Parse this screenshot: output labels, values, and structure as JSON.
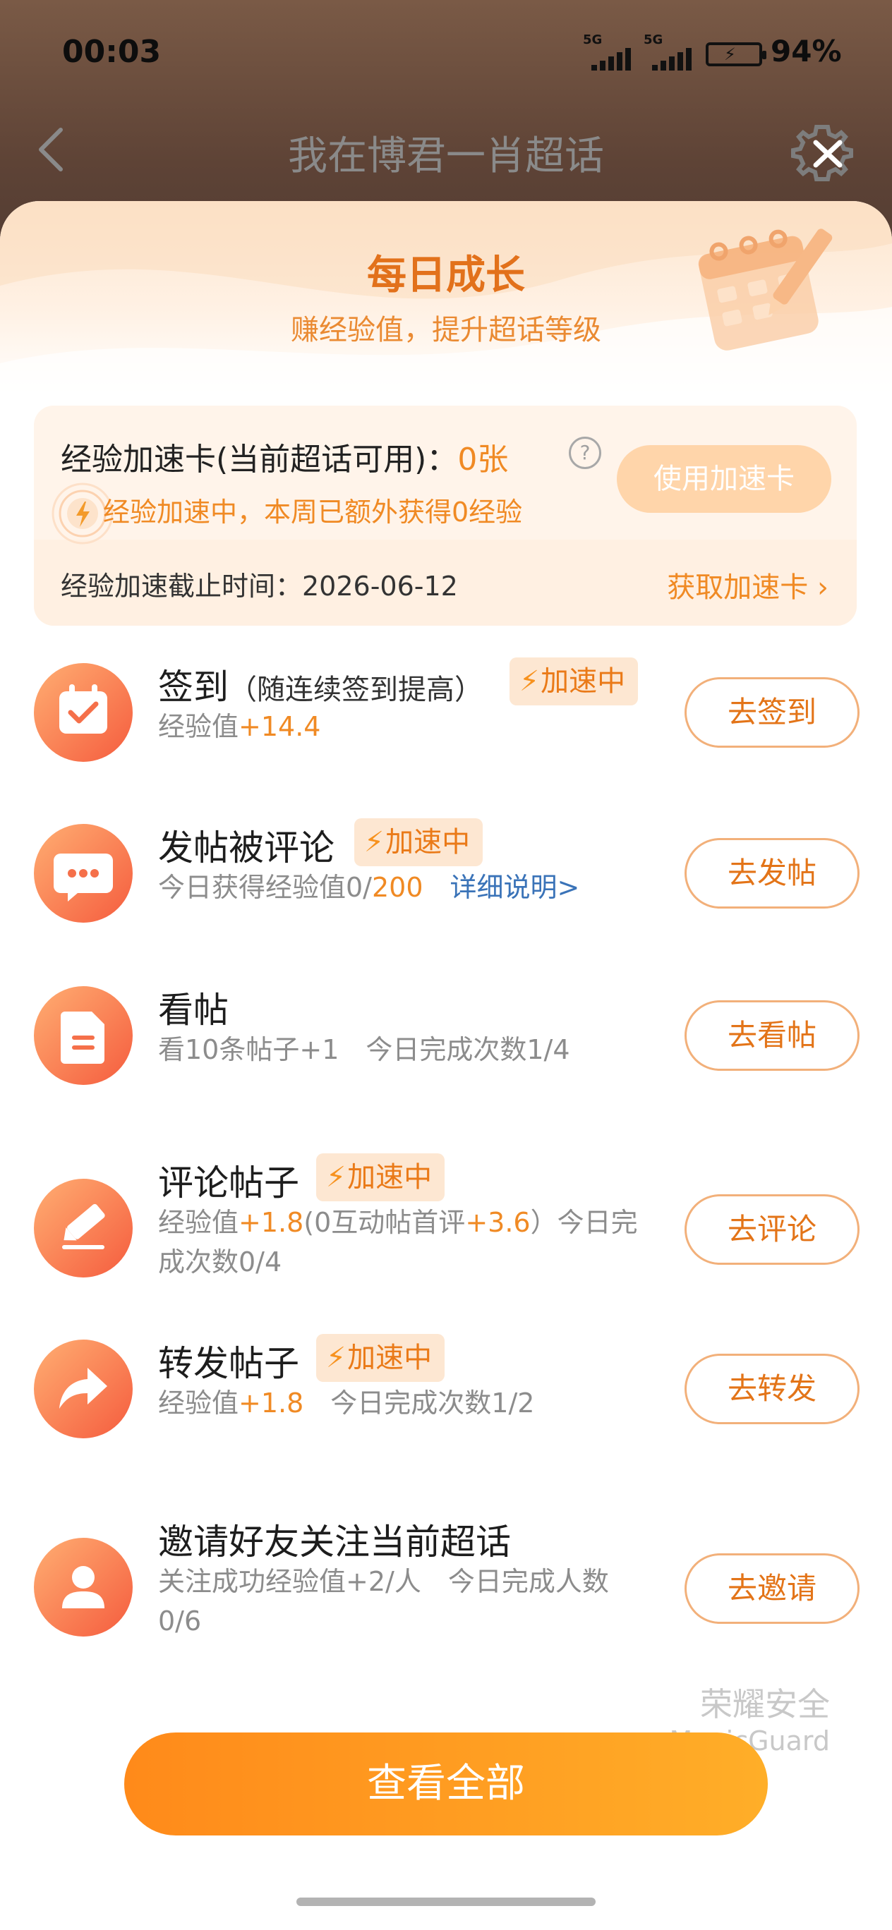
{
  "status_bar": {
    "time": "00:03",
    "signal_1": "5G",
    "signal_2": "5G",
    "battery": "94%"
  },
  "nav": {
    "title": "我在博君一肖超话"
  },
  "header": {
    "title": "每日成长",
    "subtitle": "赚经验值，提升超话等级"
  },
  "booster": {
    "label": "经验加速卡(当前超话可用)：",
    "count": "0张",
    "use_button": "使用加速卡",
    "status": "经验加速中，本周已额外获得0经验",
    "deadline": "经验加速截止时间：2026-06-12",
    "get_link": "获取加速卡"
  },
  "boost_tag": "加速中",
  "tasks": [
    {
      "name": "签到",
      "note": "（随连续签到提高）",
      "desc_prefix": "经验值",
      "desc_value": "+14.4",
      "button": "去签到"
    },
    {
      "name": "发帖被评论",
      "desc_prefix": "今日获得经验值0/",
      "desc_value": "200",
      "desc_link": "详细说明>",
      "button": "去发帖"
    },
    {
      "name": "看帖",
      "desc": "看10条帖子+1　今日完成次数1/4",
      "button": "去看帖"
    },
    {
      "name": "评论帖子",
      "desc_a": "经验值",
      "desc_b": "+1.8",
      "desc_c": "(0互动帖首评",
      "desc_d": "+3.6",
      "desc_e": "）今日完",
      "desc_line2": "成次数0/4",
      "button": "去评论"
    },
    {
      "name": "转发帖子",
      "desc_prefix": "经验值",
      "desc_value": "+1.8",
      "desc_suffix": "　今日完成次数1/2",
      "button": "去转发"
    },
    {
      "name": "邀请好友关注当前超话",
      "desc_line1": "关注成功经验值+2/人　今日完成人数",
      "desc_line2": "0/6",
      "button": "去邀请"
    }
  ],
  "watermark": {
    "line1": "荣耀安全",
    "line2": "MagicGuard"
  },
  "view_all": "查看全部",
  "icons": {
    "back": "chevron-left-icon",
    "settings": "gear-close-icon",
    "help": "question-icon",
    "speed": "lightning-icon",
    "checkin": "calendar-check-icon",
    "comment": "chat-bubble-icon",
    "read": "document-icon",
    "write": "pencil-icon",
    "share": "forward-arrow-icon",
    "invite": "user-icon"
  },
  "colors": {
    "accent": "#f08a24",
    "title_orange": "#e2711b",
    "link_blue": "#3a73b8",
    "button_gradient_start": "#ff8a1a",
    "button_gradient_end": "#ffae28"
  }
}
